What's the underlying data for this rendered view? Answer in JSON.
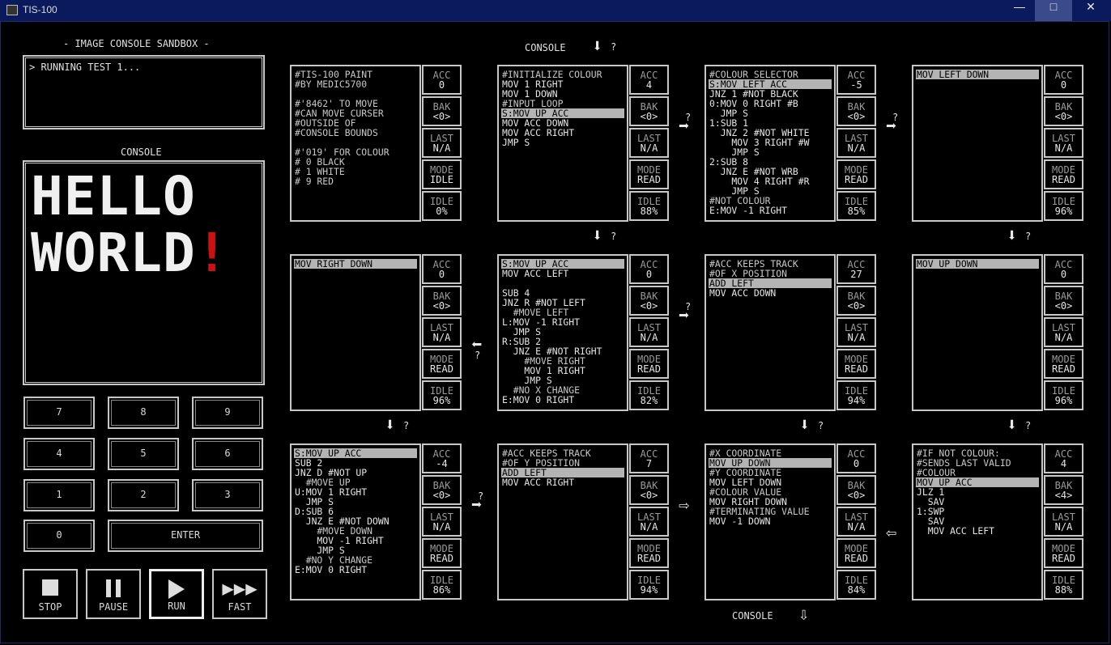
{
  "window": {
    "title": "TIS-100",
    "minimize": "—",
    "maximize": "□",
    "close": "✕"
  },
  "sidebar": {
    "header": "- IMAGE CONSOLE SANDBOX -",
    "log": "> RUNNING TEST 1...",
    "console_label": "CONSOLE",
    "display_line1": "HELLO",
    "display_line2": "WORLD",
    "display_bang": "!",
    "keys": [
      "7",
      "8",
      "9",
      "4",
      "5",
      "6",
      "1",
      "2",
      "3",
      "0"
    ],
    "enter": "ENTER",
    "controls": {
      "stop": "STOP",
      "pause": "PAUSE",
      "run": "RUN",
      "fast": "FAST"
    }
  },
  "top_label": "CONSOLE",
  "bottom_label": "CONSOLE",
  "nodes": [
    {
      "lines": [
        "#TIS-100 PAINT",
        "#BY MEDIC5700",
        "",
        "#'8462' TO MOVE",
        "#CAN MOVE CURSER",
        "#OUTSIDE OF",
        "#CONSOLE BOUNDS",
        "",
        "#'019' FOR COLOUR",
        "# 0 BLACK",
        "# 1 WHITE",
        "# 9 RED"
      ],
      "hl": -1,
      "acc": "0",
      "bak": "<0>",
      "last": "N/A",
      "mode": "IDLE",
      "idle": "0%"
    },
    {
      "lines": [
        "#INITIALIZE COLOUR",
        "MOV 1 RIGHT",
        "MOV 1 DOWN",
        "#INPUT LOOP",
        "S:MOV UP ACC",
        "MOV ACC DOWN",
        "MOV ACC RIGHT",
        "JMP S"
      ],
      "hl": 4,
      "acc": "4",
      "bak": "<0>",
      "last": "N/A",
      "mode": "READ",
      "idle": "88%"
    },
    {
      "lines": [
        "#COLOUR SELECTOR",
        "S:MOV LEFT ACC",
        "JNZ 1 #NOT BLACK",
        "0:MOV 0 RIGHT #B",
        "  JMP S",
        "1:SUB 1",
        "  JNZ 2 #NOT WHITE",
        "    MOV 3 RIGHT #W",
        "    JMP S",
        "2:SUB 8",
        "  JNZ E #NOT WRB",
        "    MOV 4 RIGHT #R",
        "    JMP S",
        "#NOT COLOUR",
        "E:MOV -1 RIGHT"
      ],
      "hl": 1,
      "acc": "-5",
      "bak": "<0>",
      "last": "N/A",
      "mode": "READ",
      "idle": "85%"
    },
    {
      "lines": [
        "MOV LEFT DOWN"
      ],
      "hl": 0,
      "acc": "0",
      "bak": "<0>",
      "last": "N/A",
      "mode": "READ",
      "idle": "96%"
    },
    {
      "lines": [
        "MOV RIGHT DOWN"
      ],
      "hl": 0,
      "acc": "0",
      "bak": "<0>",
      "last": "N/A",
      "mode": "READ",
      "idle": "96%"
    },
    {
      "lines": [
        "S:MOV UP ACC",
        "MOV ACC LEFT",
        "",
        "SUB 4",
        "JNZ R #NOT LEFT",
        "  #MOVE LEFT",
        "L:MOV -1 RIGHT",
        "  JMP S",
        "R:SUB 2",
        "  JNZ E #NOT RIGHT",
        "    #MOVE RIGHT",
        "    MOV 1 RIGHT",
        "    JMP S",
        "  #NO X CHANGE",
        "E:MOV 0 RIGHT"
      ],
      "hl": 0,
      "acc": "0",
      "bak": "<0>",
      "last": "N/A",
      "mode": "READ",
      "idle": "82%"
    },
    {
      "lines": [
        "#ACC KEEPS TRACK",
        "#OF X POSITION",
        "ADD LEFT",
        "MOV ACC DOWN"
      ],
      "hl": 2,
      "acc": "27",
      "bak": "<0>",
      "last": "N/A",
      "mode": "READ",
      "idle": "94%"
    },
    {
      "lines": [
        "MOV UP DOWN"
      ],
      "hl": 0,
      "acc": "0",
      "bak": "<0>",
      "last": "N/A",
      "mode": "READ",
      "idle": "96%"
    },
    {
      "lines": [
        "S:MOV UP ACC",
        "SUB 2",
        "JNZ D #NOT UP",
        "  #MOVE UP",
        "U:MOV 1 RIGHT",
        "  JMP S",
        "D:SUB 6",
        "  JNZ E #NOT DOWN",
        "    #MOVE DOWN",
        "    MOV -1 RIGHT",
        "    JMP S",
        "  #NO Y CHANGE",
        "E:MOV 0 RIGHT"
      ],
      "hl": 0,
      "acc": "-4",
      "bak": "<0>",
      "last": "N/A",
      "mode": "READ",
      "idle": "86%"
    },
    {
      "lines": [
        "#ACC KEEPS TRACK",
        "#OF Y POSITION",
        "ADD LEFT",
        "MOV ACC RIGHT"
      ],
      "hl": 2,
      "acc": "7",
      "bak": "<0>",
      "last": "N/A",
      "mode": "READ",
      "idle": "94%"
    },
    {
      "lines": [
        "#X COORDINATE",
        "MOV UP DOWN",
        "#Y COORDINATE",
        "MOV LEFT DOWN",
        "#COLOUR VALUE",
        "MOV RIGHT DOWN",
        "#TERMINATING VALUE",
        "MOV -1 DOWN"
      ],
      "hl": 1,
      "acc": "0",
      "bak": "<0>",
      "last": "N/A",
      "mode": "READ",
      "idle": "84%"
    },
    {
      "lines": [
        "#IF NOT COLOUR:",
        "#SENDS LAST VALID",
        "#COLOUR",
        "MOV UP ACC",
        "JLZ 1",
        "  SAV",
        "1:SWP",
        "  SAV",
        "  MOV ACC LEFT"
      ],
      "hl": 3,
      "acc": "4",
      "bak": "<4>",
      "last": "N/A",
      "mode": "READ",
      "idle": "88%"
    }
  ],
  "reg_labels": {
    "acc": "ACC",
    "bak": "BAK",
    "last": "LAST",
    "mode": "MODE",
    "idle": "IDLE"
  },
  "qmark": "?",
  "colors": {
    "bg": "#000000",
    "text": "#d9d9d9",
    "highlight": "#b4b4b4",
    "red": "#cc1111",
    "titlebar": "#0b1a5c"
  }
}
